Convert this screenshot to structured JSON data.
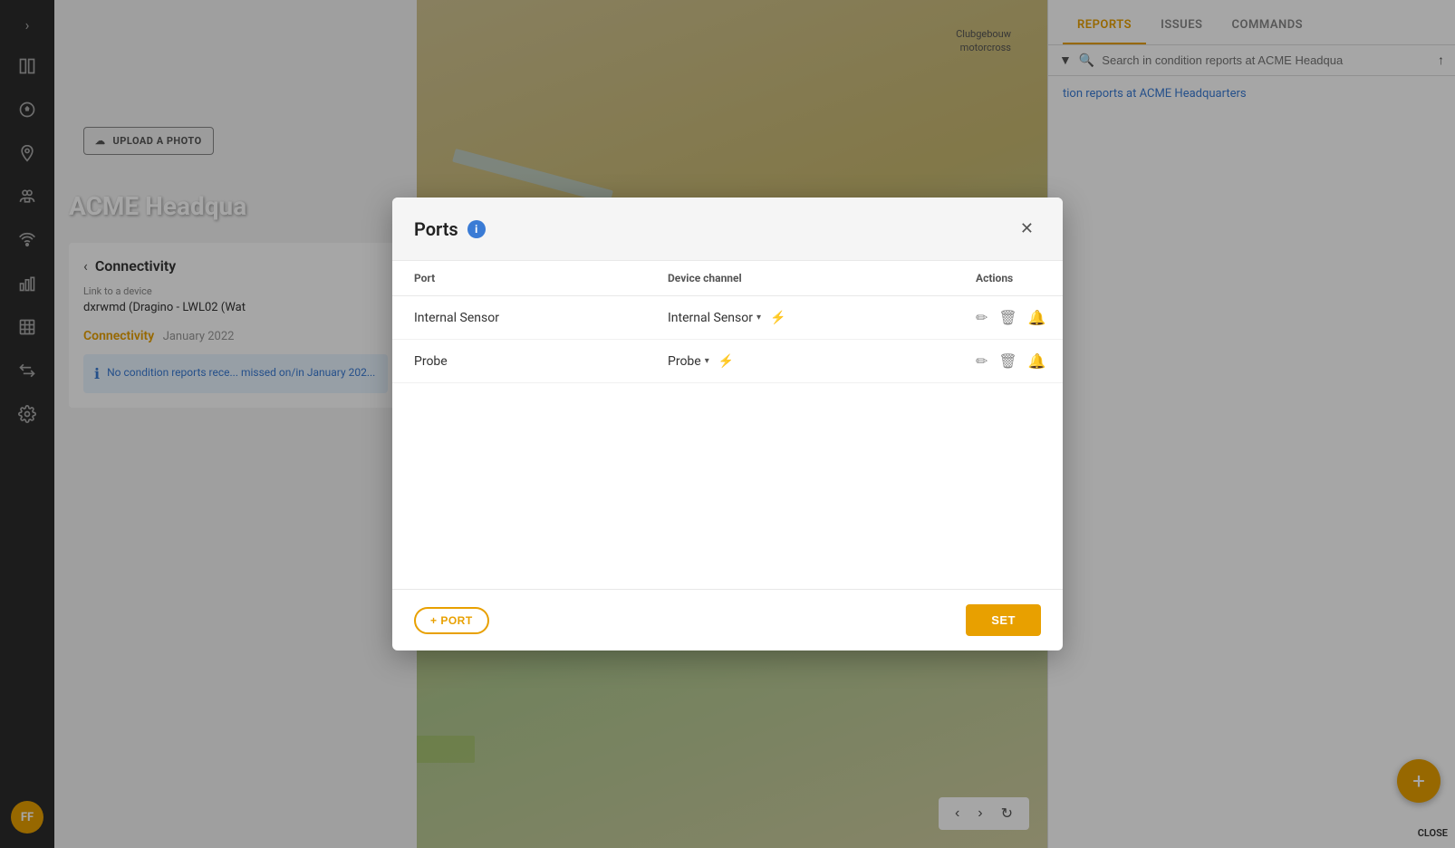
{
  "sidebar": {
    "items": [
      {
        "label": "chevron-right",
        "icon": "›"
      },
      {
        "label": "book-icon",
        "icon": "📋"
      },
      {
        "label": "soccer-icon",
        "icon": "⚽"
      },
      {
        "label": "location-icon",
        "icon": "📍"
      },
      {
        "label": "group-icon",
        "icon": "👥"
      },
      {
        "label": "wifi-icon",
        "icon": "📡"
      },
      {
        "label": "chart-icon",
        "icon": "📊"
      },
      {
        "label": "table-icon",
        "icon": "▦"
      },
      {
        "label": "transfer-icon",
        "icon": "⇅"
      },
      {
        "label": "settings-icon",
        "icon": "⚙"
      }
    ],
    "avatar": "FF"
  },
  "topbar": {
    "location": "ACME Headquarters",
    "close_icon": "✕",
    "arrow_icon": "▾"
  },
  "right_panel": {
    "tabs": [
      "REPORTS",
      "ISSUES",
      "COMMANDS"
    ],
    "active_tab": "REPORTS",
    "search_placeholder": "Search in condition reports at ACME Headqua",
    "link_text": "tion reports at ACME Headquarters"
  },
  "left_panel": {
    "upload_btn": "UPLOAD A PHOTO",
    "page_title": "ACME Headqua",
    "connectivity_label": "Connectivity",
    "back_icon": "‹",
    "link_label": "Link to a device",
    "link_value": "dxrwmd (Dragino - LWL02 (Wat",
    "connectivity_month": "Connectivity",
    "connectivity_date": "January 2022",
    "info_text": "No condition reports rece... missed on/in January 202..."
  },
  "map_controls": {
    "prev": "‹",
    "next": "›",
    "refresh": "↻"
  },
  "fab": {
    "icon": "+",
    "close_label": "CLOSE"
  },
  "modal": {
    "title": "Ports",
    "info_badge": "i",
    "close_icon": "✕",
    "table": {
      "headers": [
        "Port",
        "Device channel",
        "Actions"
      ],
      "rows": [
        {
          "port": "Internal Sensor",
          "channel": "Internal Sensor",
          "has_lightning": true
        },
        {
          "port": "Probe",
          "channel": "Probe",
          "has_lightning": true
        }
      ]
    },
    "add_port_label": "+ PORT",
    "set_label": "SET"
  }
}
